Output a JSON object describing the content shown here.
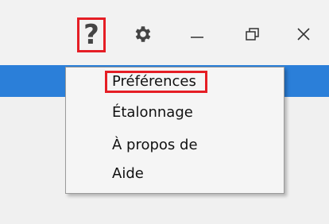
{
  "titlebar": {
    "help_glyph": "?",
    "icons": {
      "help": "help-icon",
      "settings": "gear-icon",
      "minimize": "minimize-icon",
      "restore": "restore-icon",
      "close": "close-icon"
    }
  },
  "menu": {
    "items": [
      {
        "label": "Préférences",
        "highlighted": true
      },
      {
        "label": "Étalonnage"
      },
      {
        "label": "À propos de"
      },
      {
        "label": "Aide"
      }
    ]
  },
  "colors": {
    "highlight": "#e51e25",
    "accent_band": "#2b7fd9",
    "titlebar_bg": "#f2f2f2"
  }
}
